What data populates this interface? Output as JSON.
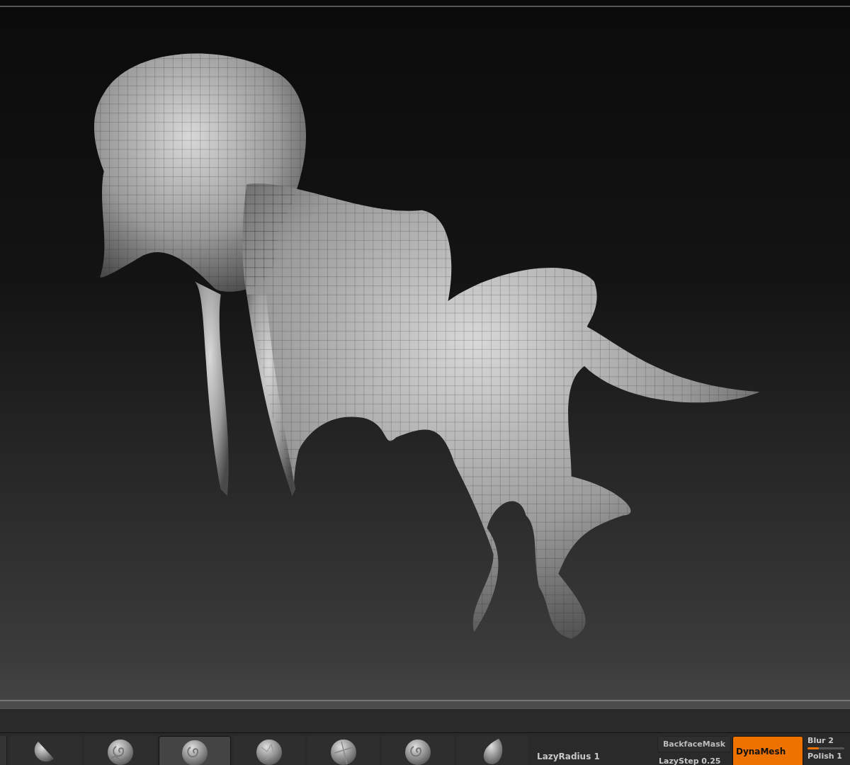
{
  "brushes": [
    {
      "kind": "half-sphere",
      "selected": false
    },
    {
      "kind": "swirl-pattern",
      "selected": false
    },
    {
      "kind": "spiral",
      "selected": true
    },
    {
      "kind": "rough",
      "selected": false
    },
    {
      "kind": "cross-cut",
      "selected": false
    },
    {
      "kind": "spiral",
      "selected": false
    },
    {
      "kind": "drop",
      "selected": false
    }
  ],
  "lazy_radius": "LazyRadius 1",
  "backface_mask": {
    "label": "BackfaceMask",
    "on": false
  },
  "lazy_step": "LazyStep 0.25",
  "dynamesh": {
    "label": "DynaMesh",
    "on": true
  },
  "blur": {
    "label": "Blur 2",
    "level": 0.3
  },
  "polish": "Polish 1"
}
